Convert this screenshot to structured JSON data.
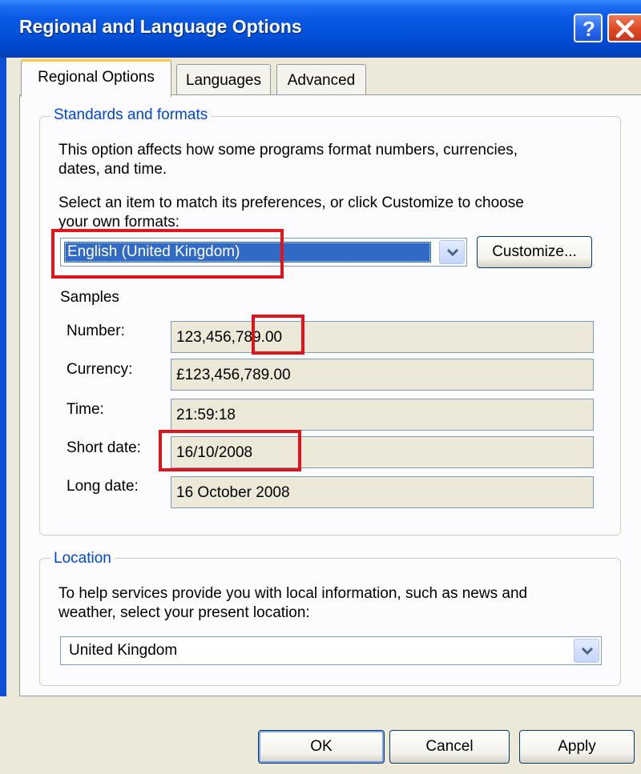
{
  "window": {
    "title": "Regional and Language Options",
    "help_symbol": "?",
    "accent_color": "#0a5ae6"
  },
  "tabs": [
    {
      "label": "Regional Options",
      "active": true
    },
    {
      "label": "Languages",
      "active": false
    },
    {
      "label": "Advanced",
      "active": false
    }
  ],
  "standards": {
    "legend": "Standards and formats",
    "description": [
      "This option affects how some programs format numbers, currencies,",
      "dates, and time."
    ],
    "select_prompt": [
      "Select an item to match its preferences, or click Customize to choose",
      "your own formats:"
    ],
    "selected_format": "English (United Kingdom)",
    "customize_label": "Customize...",
    "samples_label": "Samples",
    "samples": [
      {
        "label": "Number:",
        "value": "123,456,789.00"
      },
      {
        "label": "Currency:",
        "value": "£123,456,789.00"
      },
      {
        "label": "Time:",
        "value": "21:59:18"
      },
      {
        "label": "Short date:",
        "value": "16/10/2008"
      },
      {
        "label": "Long date:",
        "value": "16 October 2008"
      }
    ]
  },
  "location": {
    "legend": "Location",
    "description": [
      "To help services provide you with local information, such as news and",
      "weather, select your present location:"
    ],
    "selected_location": "United Kingdom"
  },
  "buttons": {
    "ok": "OK",
    "cancel": "Cancel",
    "apply": "Apply"
  },
  "icons": {
    "help": "help-icon",
    "close": "close-icon",
    "dropdown": "chevron-down-icon"
  },
  "highlight_color": "#e0141c"
}
